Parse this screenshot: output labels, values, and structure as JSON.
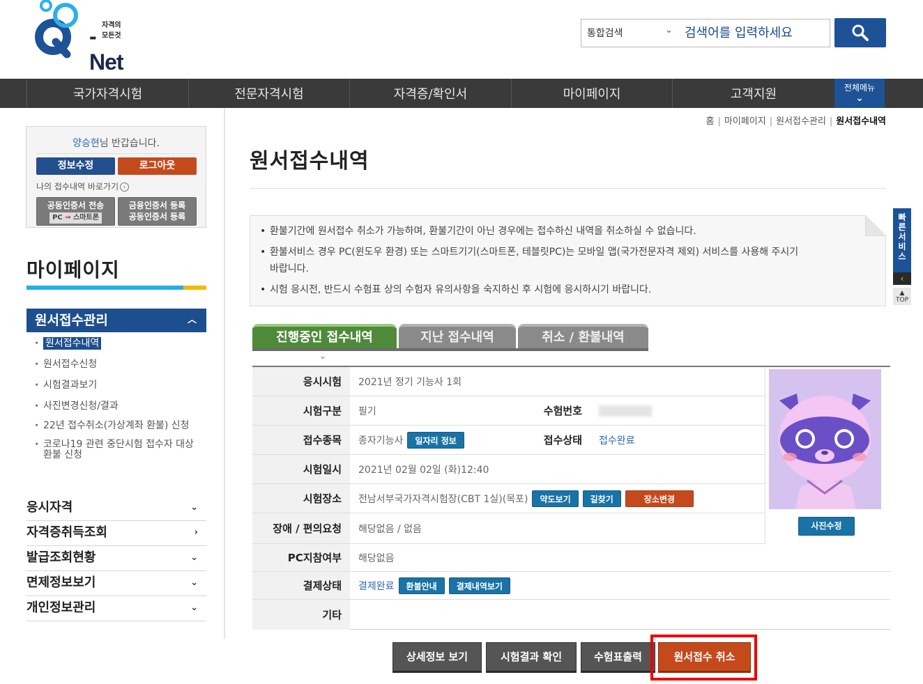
{
  "header": {
    "logo_tagline": "자격의 모든것",
    "logo_text": "-Net",
    "search_category": "통합검색",
    "search_placeholder": "검색어를 입력하세요"
  },
  "gnb": [
    "국가자격시험",
    "전문자격시험",
    "자격증/확인서",
    "마이페이지",
    "고객지원"
  ],
  "gnb_all": "전체메뉴",
  "login_box": {
    "user_name": "양승현",
    "greeting": "님 반갑습니다.",
    "edit_btn": "정보수정",
    "logout_btn": "로그아웃",
    "shortcut": "나의 접수내역 바로가기",
    "cert_transfer_l1": "공동인증서 전송",
    "cert_transfer_l2_a": "PC",
    "cert_transfer_l2_arrow": "⇒",
    "cert_transfer_l2_b": "스마트폰",
    "fin_cert_l1": "금융인증서 등록",
    "fin_cert_l2": "공동인증서 등록"
  },
  "sidebar": {
    "title": "마이페이지",
    "section": "원서접수관리",
    "submenu": [
      "원서접수내역",
      "원서접수신청",
      "시험결과보기",
      "사진변경신청/결과",
      "22년 접수취소(가상계좌 환불) 신청",
      "코로나19 관련 중단시험 접수자 대상 환불 신청"
    ],
    "menus": [
      "응시자격",
      "자격증취득조회",
      "발급조회현황",
      "면제정보보기",
      "개인정보관리"
    ]
  },
  "breadcrumb": [
    "홈",
    "마이페이지",
    "원서접수관리",
    "원서접수내역"
  ],
  "page_title": "원서접수내역",
  "notice": [
    "환불기간에 원서접수 취소가 가능하며, 환불기간이 아닌 경우에는 접수하신 내역을 취소하실 수 없습니다.",
    "환불서비스 경우 PC(윈도우 환경) 또는 스마트기기(스마트폰, 테블릿PC)는 모바일 앱(국가전문자격 제외) 서비스를 사용해 주시기 바랍니다.",
    "시험 응시전, 반드시 수험표 상의 수험자 유의사항을 숙지하신 후 시험에 응시하시기 바랍니다."
  ],
  "quick_menu": {
    "label": "빠른서비스",
    "top": "TOP"
  },
  "tabs": [
    "진행중인 접수내역",
    "지난 접수내역",
    "취소 / 환불내역"
  ],
  "detail": {
    "exam_label": "응시시험",
    "exam_value": "2021년 정기 기능사 1회",
    "type_label": "시험구분",
    "type_value": "필기",
    "number_label": "수험번호",
    "subject_label": "접수종목",
    "subject_value": "종자기능사",
    "job_btn": "일자리 정보",
    "status_label": "접수상태",
    "status_value": "접수완료",
    "datetime_label": "시험일시",
    "datetime_value": "2021년 02월 02일 (화)12:40",
    "place_label": "시험장소",
    "place_value": "전남서부국가자격시험장(CBT 1실)(목포)",
    "map_btn": "약도보기",
    "route_btn": "길찾기",
    "change_btn": "장소변경",
    "disability_label": "장애 / 편의요청",
    "disability_value": "해당없음 / 없음",
    "pc_label": "PC지참여부",
    "pc_value": "해당없음",
    "payment_label": "결제상태",
    "payment_value": "결제완료",
    "refund_btn": "환불안내",
    "payhist_btn": "결제내역보기",
    "etc_label": "기타",
    "photo_btn": "사진수정"
  },
  "bottom_buttons": [
    "상세정보 보기",
    "시험결과 확인",
    "수험표출력",
    "원서접수 취소"
  ],
  "colors": {
    "brand_blue": "#1d5296",
    "accent_orange": "#c44a1c",
    "tab_green": "#4f8a3b",
    "highlight": "#ee0000"
  }
}
